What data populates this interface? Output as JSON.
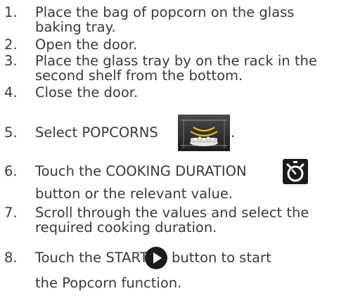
{
  "steps": [
    {
      "num": "1.",
      "text": "Place the bag of popcorn on the glass baking tray."
    },
    {
      "num": "2.",
      "text": "Open the door."
    },
    {
      "num": "3.",
      "text": "Place the glass tray by on the rack in the second shelf from the bottom."
    },
    {
      "num": "4.",
      "text": "Close the door."
    },
    {
      "num": "5.",
      "text_before": "Select POPCORNS",
      "text_after": ".",
      "icon": "popcorn-program-icon"
    },
    {
      "num": "6.",
      "text_before": "Touch the COOKING DURATION",
      "text_after": "button or the relevant value.",
      "icon": "stopwatch-icon"
    },
    {
      "num": "7.",
      "text": "Scroll through the values and select the required cooking duration."
    },
    {
      "num": "8.",
      "text_before": "Touch the START",
      "text_after": "button to start the Popcorn function.",
      "icon": "play-icon"
    }
  ]
}
